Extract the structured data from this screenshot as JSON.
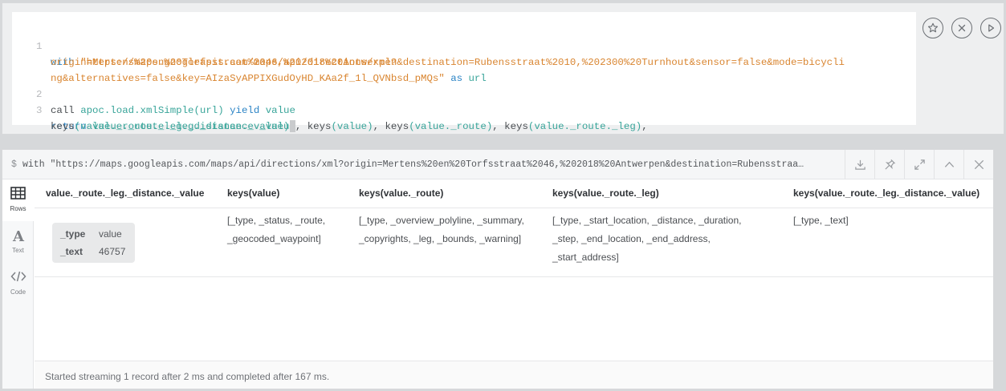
{
  "editor": {
    "line_numbers": [
      "1",
      "2",
      "3"
    ],
    "line1_kw": "with",
    "line1_str_a": "\"https://maps.googleapis.com/maps/api/directions/xml?",
    "line1_str_b": "origin=Mertens%20en%20Torfsstraat%2046,%202018%20Antwerpen&destination=Rubensstraat%2010,%202300%20Turnhout&sensor=false&mode=bicycli",
    "line1_str_c": "ng&alternatives=false&key=AIzaSyAPPIXGudOyHD_KAa2f_1l_QVNbsd_pMQs\"",
    "line1_as": "as",
    "line1_var": "url",
    "line2_call": "call",
    "line2_proc": "apoc.load.xmlSimple",
    "line2_arg": "(url)",
    "line2_yield": "yield",
    "line2_value": "value",
    "line3_return": "return",
    "line3_a": "value._route._leg._distance._value",
    "line3_keys1": "keys",
    "line3_b": "(value)",
    "line3_keys2": "keys",
    "line3_c": "(value._route)",
    "line3_keys3": "keys",
    "line3_d": "(value._route._leg)",
    "line3_keys4": "keys",
    "line3_e": "(value._route._leg._distance._value)"
  },
  "editor_actions": [
    "star-icon",
    "close-icon",
    "play-icon"
  ],
  "result": {
    "prompt": "$",
    "query_echo": "with \"https://maps.googleapis.com/maps/api/directions/xml?origin=Mertens%20en%20Torfsstraat%2046,%202018%20Antwerpen&destination=Rubensstraa…",
    "header_actions": [
      "download-icon",
      "pin-icon",
      "expand-icon",
      "collapse-icon",
      "close-icon"
    ]
  },
  "side_tabs": [
    {
      "label": "Rows",
      "icon": "table-icon",
      "active": true
    },
    {
      "label": "Text",
      "icon": "text-icon",
      "active": false
    },
    {
      "label": "Code",
      "icon": "code-icon",
      "active": false
    }
  ],
  "table": {
    "headers": [
      "value._route._leg._distance._value",
      "keys(value)",
      "keys(value._route)",
      "keys(value._route._leg)",
      "keys(value._route._leg._distance._value)"
    ],
    "row": {
      "map": [
        {
          "key": "_type",
          "value": "value"
        },
        {
          "key": "_text",
          "value": "46757"
        }
      ],
      "col2": [
        "[_type, _status, _route,",
        "_geocoded_waypoint]"
      ],
      "col3": [
        "[_type, _overview_polyline, _summary,",
        "_copyrights, _leg, _bounds, _warning]"
      ],
      "col4": [
        "[_type, _start_location, _distance, _duration,",
        "_step, _end_location, _end_address,",
        "_start_address]"
      ],
      "col5": [
        "[_type, _text]"
      ]
    }
  },
  "status": "Started streaming 1 record after 2 ms and completed after 167 ms."
}
